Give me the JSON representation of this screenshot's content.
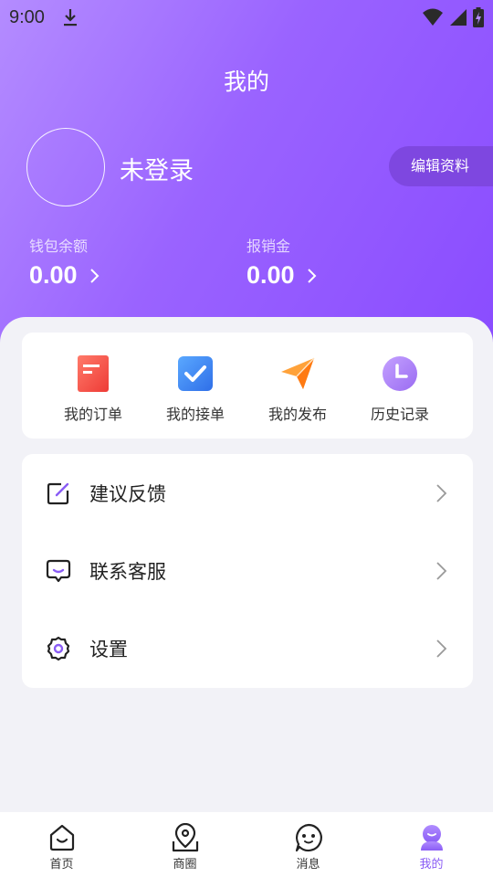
{
  "status_bar": {
    "time": "9:00"
  },
  "header": {
    "title": "我的",
    "login_label": "未登录",
    "edit_profile": "编辑资料"
  },
  "wallet": {
    "balance_label": "钱包余额",
    "balance_value": "0.00",
    "reimburse_label": "报销金",
    "reimburse_value": "0.00"
  },
  "quick_actions": [
    {
      "label": "我的订单",
      "icon": "order-icon",
      "color": "#f4544c"
    },
    {
      "label": "我的接单",
      "icon": "accepted-check-icon",
      "color": "#3d82f3"
    },
    {
      "label": "我的发布",
      "icon": "paper-plane-icon",
      "color": "#ff8c1a"
    },
    {
      "label": "历史记录",
      "icon": "clock-icon",
      "color": "#a779f5"
    }
  ],
  "menu": [
    {
      "label": "建议反馈",
      "icon": "edit-icon"
    },
    {
      "label": "联系客服",
      "icon": "chat-bubble-icon"
    },
    {
      "label": "设置",
      "icon": "gear-icon"
    }
  ],
  "tabbar": [
    {
      "label": "首页",
      "icon": "home-icon",
      "active": false
    },
    {
      "label": "商圈",
      "icon": "map-pin-icon",
      "active": false
    },
    {
      "label": "消息",
      "icon": "message-icon",
      "active": false
    },
    {
      "label": "我的",
      "icon": "profile-icon",
      "active": true
    }
  ],
  "colors": {
    "accent": "#8a5cf5",
    "header_start": "#b48cff",
    "header_end": "#8a4cff"
  }
}
